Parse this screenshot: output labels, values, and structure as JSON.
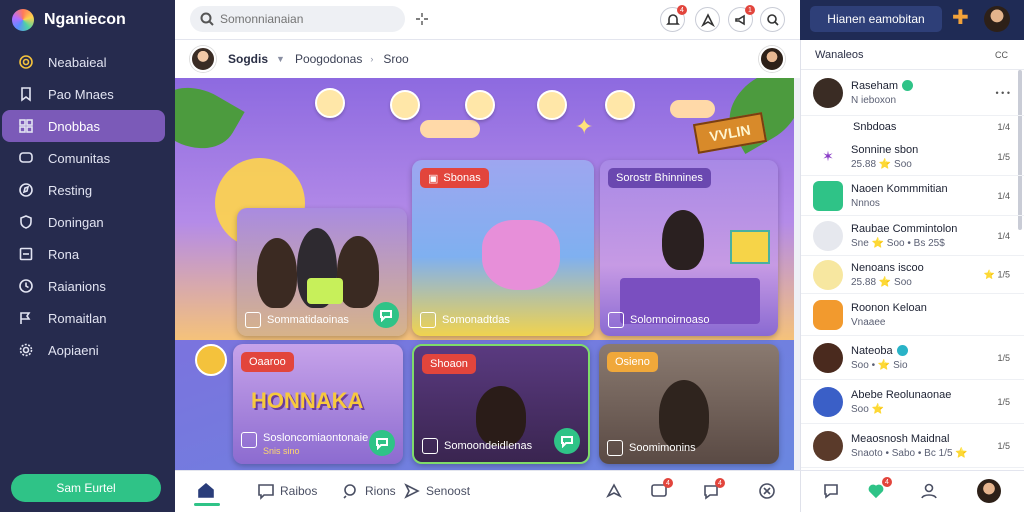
{
  "app": {
    "name": "Nganiecon"
  },
  "sidebar": {
    "items": [
      {
        "label": "Neabaieal",
        "icon": "coin-icon"
      },
      {
        "label": "Pao Mnaes",
        "icon": "bookmark-icon"
      },
      {
        "label": "Dnobbas",
        "icon": "grid-icon",
        "active": true
      },
      {
        "label": "Comunitas",
        "icon": "chat-icon"
      },
      {
        "label": "Resting",
        "icon": "compass-icon"
      },
      {
        "label": "Doningan",
        "icon": "shield-icon"
      },
      {
        "label": "Rona",
        "icon": "square-icon"
      },
      {
        "label": "Raianions",
        "icon": "clock-icon"
      },
      {
        "label": "Romaitlan",
        "icon": "flag-icon"
      },
      {
        "label": "Aopiaeni",
        "icon": "gear-icon"
      }
    ],
    "cta_label": "Sam Eurtel"
  },
  "topbar": {
    "search_placeholder": "Somonnianaian",
    "notif_counts": [
      "4",
      "",
      "1",
      ""
    ]
  },
  "subheader": {
    "crumbs": [
      "Sogdis",
      "Poogodonas",
      "Sroo"
    ]
  },
  "hero": {
    "sign_text": "VVLIN"
  },
  "cards": [
    {
      "caption": "Sommatidaoinas",
      "tag": "",
      "sub": ""
    },
    {
      "caption": "Somonadtdas",
      "tag": "Sbonas",
      "sub": ""
    },
    {
      "caption": "Solomnoirnoaso",
      "tag": "Sorostr Bhinnines",
      "sub": ""
    },
    {
      "caption": "Sosloncomiaontonaie",
      "tag": "Oaaroo",
      "sub": "Snis sino",
      "banner": "HONNAKA"
    },
    {
      "caption": "Somoondeidlenas",
      "tag": "Shoaon",
      "sub": ""
    },
    {
      "caption": "Soomimonins",
      "tag": "Osieno",
      "sub": ""
    }
  ],
  "bottomnav": {
    "items": [
      "Raibos",
      "Rions",
      "Senoost"
    ],
    "counts": [
      "4",
      "4"
    ]
  },
  "rightpanel": {
    "top_pill": "Hianen eamobitan",
    "header": "Wanaleos",
    "header_x": "CC",
    "items": [
      {
        "name": "Raseham",
        "meta": "N ieboxon",
        "time": "• • •",
        "thumb_color": "#3a2c24",
        "badge": "green"
      },
      {
        "name": "Snbdoas",
        "meta": "",
        "time": "1/4",
        "thumb_color": "",
        "badge": ""
      },
      {
        "name": "Sonnine sbon",
        "meta": "25.88 ⭐ Soo",
        "time": "1/5",
        "thumb_color": "#8a3cc7",
        "badge": ""
      },
      {
        "name": "Naoen Kommmitian",
        "meta": "Nnnos",
        "time": "1/4",
        "thumb_color": "#2fc387",
        "badge": ""
      },
      {
        "name": "Raubae Commintolon",
        "meta": "Sne ⭐ Soo • Bs 25$",
        "time": "1/4",
        "thumb_color": "#c7c9d1",
        "badge": ""
      },
      {
        "name": "Nenoans iscoo",
        "meta": "25.88 ⭐ Soo",
        "time": "⭐ 1/5",
        "thumb_color": "#f3d97a",
        "badge": ""
      },
      {
        "name": "Roonon Keloan",
        "meta": "Vnaaee",
        "time": "",
        "thumb_color": "#f29a2e",
        "badge": ""
      },
      {
        "name": "Nateoba",
        "meta": "Soo • ⭐ Sio",
        "time": "1/5",
        "thumb_color": "#4a2a1e",
        "badge": "teal"
      },
      {
        "name": "Abebe Reolunaonae",
        "meta": "Soo ⭐",
        "time": "1/5",
        "thumb_color": "#3a5fc7",
        "badge": ""
      },
      {
        "name": "Meaosnosh Maidnal",
        "meta": "Snaoto • Sabo • Bc 1/5 ⭐",
        "time": "1/5",
        "thumb_color": "#5a3a2a",
        "badge": ""
      }
    ],
    "bottom_count": "4"
  }
}
